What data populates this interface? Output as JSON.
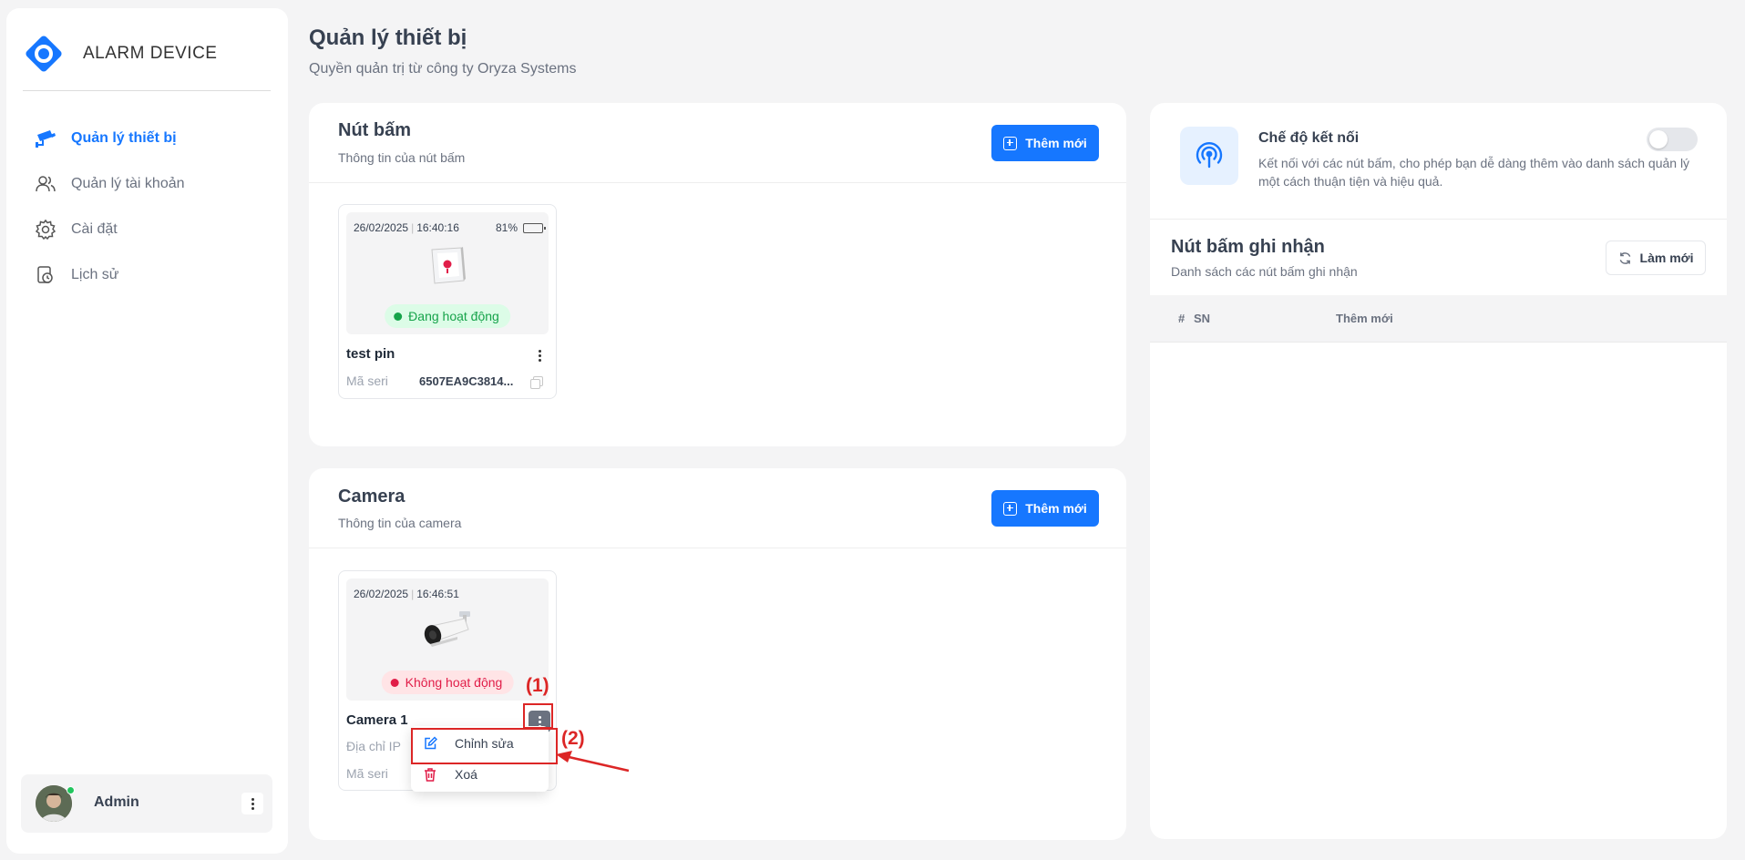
{
  "brand": {
    "name": "ALARM DEVICE"
  },
  "nav": {
    "items": [
      {
        "label": "Quản lý thiết bị",
        "icon": "cctv-icon",
        "active": true
      },
      {
        "label": "Quản lý tài khoản",
        "icon": "users-icon",
        "active": false
      },
      {
        "label": "Cài đặt",
        "icon": "gear-icon",
        "active": false
      },
      {
        "label": "Lịch sử",
        "icon": "history-icon",
        "active": false
      }
    ]
  },
  "user": {
    "name": "Admin",
    "status": "online"
  },
  "page": {
    "title": "Quản lý thiết bị",
    "subtitle": "Quyền quản trị từ công ty Oryza Systems"
  },
  "buttons_section": {
    "title": "Nút bấm",
    "subtitle": "Thông tin của nút bấm",
    "add_label": "Thêm mới",
    "devices": [
      {
        "date": "26/02/2025",
        "time": "16:40:16",
        "battery": "81%",
        "battery_level": 0.81,
        "status": "Đang hoạt động",
        "name": "test pin",
        "serial_label": "Mã seri",
        "serial_value": "6507EA9C3814..."
      }
    ]
  },
  "camera_section": {
    "title": "Camera",
    "subtitle": "Thông tin của camera",
    "add_label": "Thêm mới",
    "devices": [
      {
        "date": "26/02/2025",
        "time": "16:46:51",
        "status": "Không hoạt động",
        "name": "Camera 1",
        "ip_label": "Địa chỉ IP",
        "serial_label": "Mã seri"
      }
    ]
  },
  "context_menu": {
    "edit_label": "Chỉnh sửa",
    "delete_label": "Xoá"
  },
  "annotations": {
    "step1": "(1)",
    "step2": "(2)"
  },
  "connect_mode": {
    "title": "Chế độ kết nối",
    "description": "Kết nối với các nút bấm, cho phép bạn dễ dàng thêm vào danh sách quản lý một cách thuận tiện và hiệu quả.",
    "enabled": false
  },
  "recorded": {
    "title": "Nút bấm ghi nhận",
    "subtitle": "Danh sách các nút bấm ghi nhận",
    "refresh_label": "Làm mới",
    "columns": [
      "#",
      "SN",
      "Thêm mới"
    ]
  },
  "colors": {
    "primary": "#1677ff",
    "active_green": "#16a34a",
    "inactive_red": "#e11d48",
    "annotation_red": "#dc2626"
  }
}
